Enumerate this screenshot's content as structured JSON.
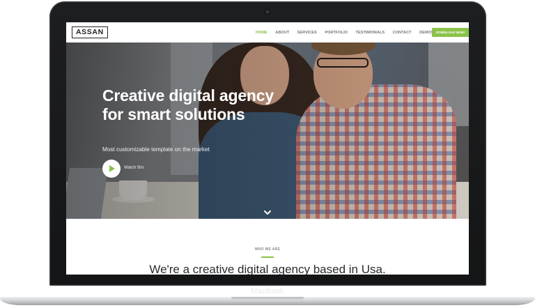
{
  "device": {
    "label": "MacBook"
  },
  "navbar": {
    "logo": "ASSAN",
    "items": [
      {
        "label": "HOME",
        "active": true
      },
      {
        "label": "ABOUT",
        "active": false
      },
      {
        "label": "SERVICES",
        "active": false
      },
      {
        "label": "PORTFOLIO",
        "active": false
      },
      {
        "label": "TESTIMONIALS",
        "active": false
      },
      {
        "label": "CONTACT",
        "active": false
      },
      {
        "label": "DEMOS",
        "active": false
      }
    ],
    "download_label": "DOWNLOAD NEW!"
  },
  "hero": {
    "title_line1": "Creative digital agency",
    "title_line2": "for smart solutions",
    "subtitle": "Most customizable template on the market",
    "watch_label": "Watch film",
    "scroll_icon": "chevron-down-icon",
    "play_icon": "play-icon"
  },
  "section": {
    "eyebrow": "WHO WE ARE",
    "heading": "We're a creative digital agency based in Usa."
  },
  "colors": {
    "accent": "#8bc34a",
    "nav_text": "#777777",
    "laptop_body": "#1d1e20"
  }
}
